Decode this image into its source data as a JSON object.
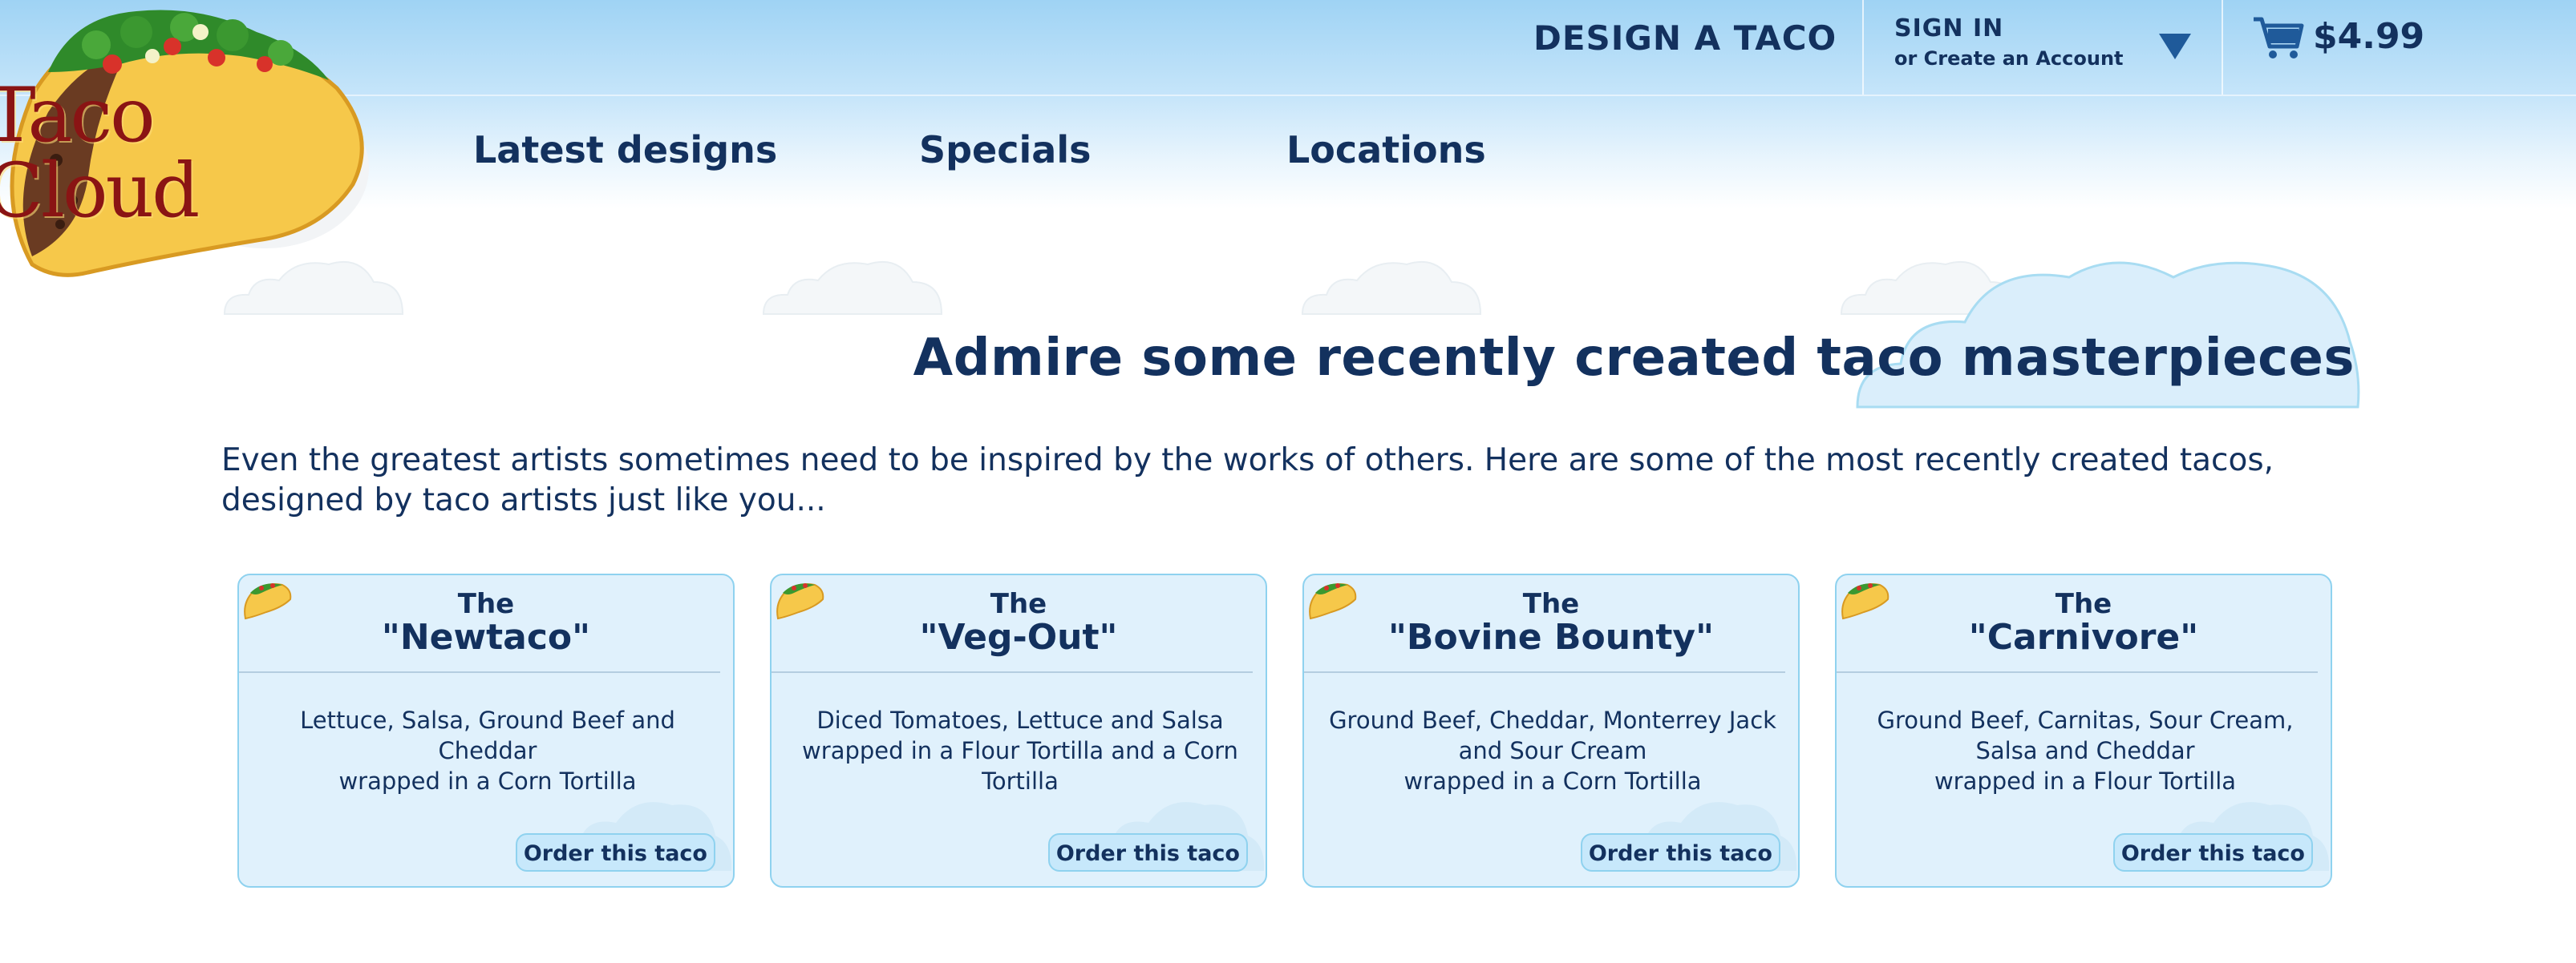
{
  "brand": {
    "logo_text": "Taco Cloud"
  },
  "header": {
    "design_link": "DESIGN A TACO",
    "sign_in": "SIGN IN",
    "create_account": "or Create an Account",
    "cart_total": "$4.99"
  },
  "nav": {
    "items": [
      {
        "label": "Latest designs"
      },
      {
        "label": "Specials"
      },
      {
        "label": "Locations"
      }
    ]
  },
  "main": {
    "heading": "Admire some recently created taco masterpieces",
    "intro": "Even the greatest artists sometimes need to be inspired by the works of others. Here are some of the most recently created tacos, designed by taco artists just like you..."
  },
  "cards": [
    {
      "prefix": "The",
      "name": "\"Newtaco\"",
      "ingredients": "Lettuce, Salsa, Ground Beef and Cheddar",
      "wrap": "wrapped in a Corn Tortilla",
      "button": "Order this taco"
    },
    {
      "prefix": "The",
      "name": "\"Veg-Out\"",
      "ingredients": "Diced Tomatoes, Lettuce and Salsa",
      "wrap": "wrapped in a Flour Tortilla and a Corn Tortilla",
      "button": "Order this taco"
    },
    {
      "prefix": "The",
      "name": "\"Bovine Bounty\"",
      "ingredients": "Ground Beef, Cheddar, Monterrey Jack and Sour Cream",
      "wrap": "wrapped in a Corn Tortilla",
      "button": "Order this taco"
    },
    {
      "prefix": "The",
      "name": "\"Carnivore\"",
      "ingredients": "Ground Beef, Carnitas, Sour Cream, Salsa and Cheddar",
      "wrap": "wrapped in a Flour Tortilla",
      "button": "Order this taco"
    }
  ],
  "icons": {
    "logo": "taco-logo",
    "dropdown": "triangle-down-icon",
    "cart": "shopping-cart-icon",
    "card": "taco-icon"
  },
  "colors": {
    "text": "#13315e",
    "sky": "#9fd3f4",
    "card_bg": "#e0f1fc",
    "card_border": "#8fd2ef",
    "logo_text": "#8a1414"
  }
}
